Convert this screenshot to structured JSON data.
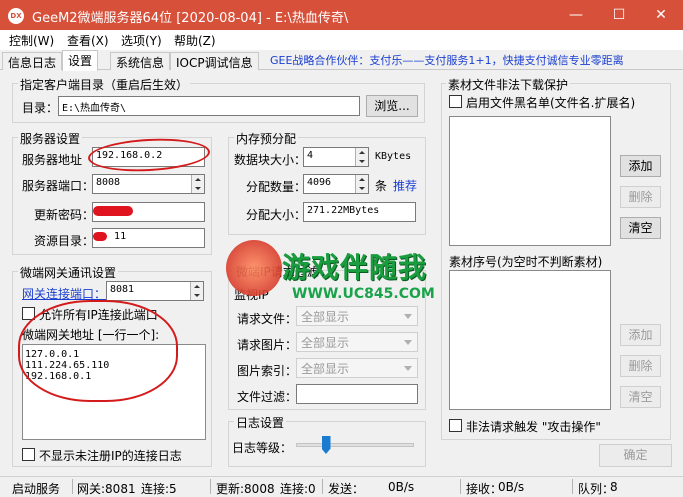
{
  "window": {
    "title": "GeeM2微端服务器64位 [2020-08-04] - E:\\热血传奇\\",
    "icon": "DX"
  },
  "controls": {
    "minimize": "—",
    "maximize": "☐",
    "close": "✕"
  },
  "menu": [
    "控制(W)",
    "查看(X)",
    "选项(Y)",
    "帮助(Z)"
  ],
  "tabs": [
    "信息日志",
    "设置",
    "系统信息",
    "IOCP调试信息"
  ],
  "promo": "GEE战略合作伙伴：支付乐——支付服务1+1，快捷支付诚信专业零距离",
  "client_dir": {
    "group": "指定客户端目录（重启后生效）",
    "label": "目录：",
    "value": "E:\\热血传奇\\",
    "browse": "浏览..."
  },
  "server": {
    "group": "服务器设置",
    "addr_label": "服务器地址",
    "addr": "192.168.0.2",
    "port_label": "服务器端口：",
    "port": "8008",
    "pwd_label": "更新密码：",
    "res_label": "资源目录：",
    "res": "-- 11"
  },
  "memory": {
    "group": "内存预分配",
    "block_label": "数据块大小：",
    "block": "4",
    "block_unit": "KBytes",
    "count_label": "分配数量：",
    "count": "4096",
    "count_unit": "条",
    "recommend": "推荐",
    "size_label": "分配大小：",
    "size": "271.22MBytes"
  },
  "gateway": {
    "group": "微端网关通讯设置",
    "port_label": "网关连接端口：",
    "port": "8081",
    "allow_all": "允许所有IP连接此端口",
    "addr_label": "微端网关地址 [一行一个]:",
    "addresses": [
      "127.0.0.1",
      "111.224.65.110",
      "192.168.0.1"
    ],
    "hide_log": "不显示未注册IP的连接日志"
  },
  "request": {
    "group": "微端IP请求过滤",
    "monitor": "监视IP",
    "file_label": "请求文件：",
    "file": "全部显示",
    "image_label": "请求图片：",
    "image": "全部显示",
    "index_label": "图片索引：",
    "index": "全部显示",
    "filter_label": "文件过滤："
  },
  "log": {
    "group": "日志设置",
    "level_label": "日志等级：",
    "level": 0.25
  },
  "material": {
    "group": "素材文件非法下载保护",
    "blacklist": "启用文件黑名单(文件名.扩展名)",
    "add": "添加",
    "delete": "删除",
    "clear": "清空",
    "seq_label": "素材序号(为空时不判断素材)",
    "add2": "添加",
    "delete2": "删除",
    "clear2": "清空",
    "attack": "非法请求触发 \"攻击操作\""
  },
  "confirm": "确定",
  "watermark": {
    "title": "游戏伴随我",
    "url": "WWW.UC845.COM"
  },
  "status": {
    "service": "启动服务",
    "gateway": "网关:8081",
    "gateway_conn": "连接:5",
    "update": "更新:8008",
    "update_conn": "连接:0",
    "send": "发送：",
    "send_rate": "0B/s",
    "recv": "接收：",
    "recv_rate": "0B/s",
    "queue": "队列：",
    "queue_val": "8"
  }
}
